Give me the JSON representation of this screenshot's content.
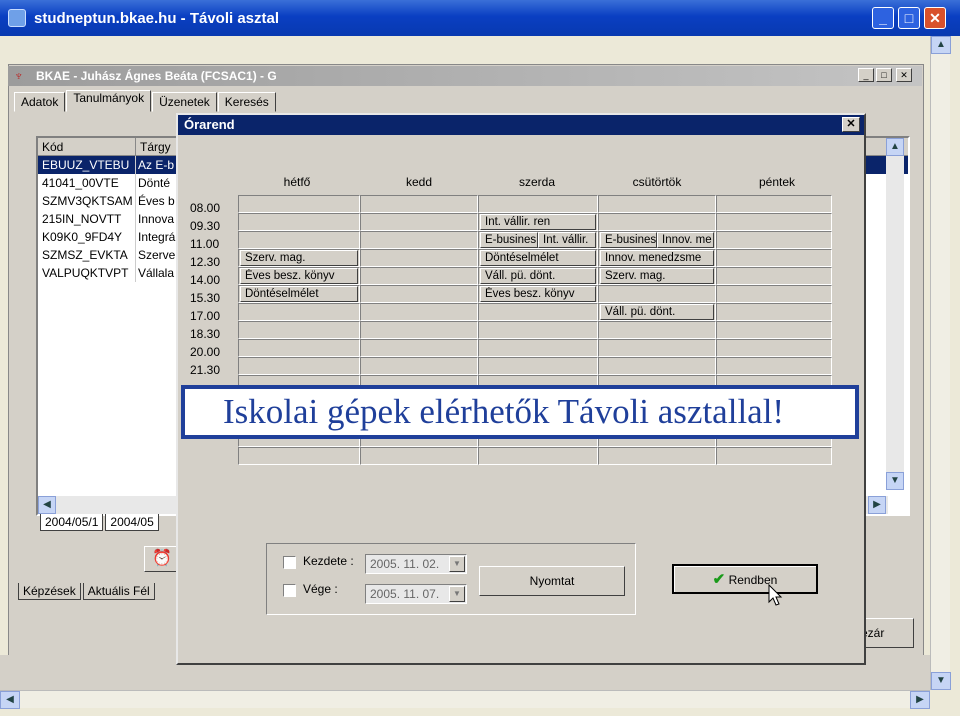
{
  "window": {
    "title": "studneptun.bkae.hu - Távoli asztal"
  },
  "app": {
    "title": "BKAE - Juhász Ágnes Beáta (FCSAC1) - G"
  },
  "tabs": [
    "Adatok",
    "Tanulmányok",
    "Üzenetek",
    "Keresés"
  ],
  "list": {
    "headers": [
      "Kód",
      "Tárgy"
    ],
    "rows": [
      {
        "code": "EBUUZ_VTEBU",
        "subject": "Az E-b",
        "selected": true
      },
      {
        "code": "41041_00VTE",
        "subject": "Dönté"
      },
      {
        "code": "SZMV3QKTSAM",
        "subject": "Éves b"
      },
      {
        "code": "215IN_NOVTT",
        "subject": "Innova"
      },
      {
        "code": "K09K0_9FD4Y",
        "subject": "Integrá"
      },
      {
        "code": "SZMSZ_EVKTA",
        "subject": "Szerve"
      },
      {
        "code": "VALPUQKTVPT",
        "subject": "Vállala"
      }
    ]
  },
  "semester_tabs": [
    "2004/05/1",
    "2004/05"
  ],
  "bottom_tabs": [
    "Képzések",
    "Aktuális Fél"
  ],
  "right_button": "ezár",
  "dialog": {
    "title": "Órarend",
    "days": [
      "hétfő",
      "kedd",
      "szerda",
      "csütörtök",
      "péntek"
    ],
    "times": [
      "08.00",
      "09.30",
      "11.00",
      "12.30",
      "14.00",
      "15.30",
      "17.00",
      "18.30",
      "20.00",
      "21.30"
    ],
    "events": [
      {
        "day": 0,
        "slot": 3,
        "label": "Szerv. mag."
      },
      {
        "day": 0,
        "slot": 4,
        "label": "Éves besz. könyv"
      },
      {
        "day": 0,
        "slot": 5,
        "label": "Döntéselmélet"
      },
      {
        "day": 2,
        "slot": 1,
        "label": "Int. vállir. ren"
      },
      {
        "day": 2,
        "slot": 2,
        "label": "E-busines",
        "half": 1
      },
      {
        "day": 2,
        "slot": 2,
        "label": "Int. vállir.",
        "half": 2
      },
      {
        "day": 2,
        "slot": 3,
        "label": "Döntéselmélet"
      },
      {
        "day": 2,
        "slot": 4,
        "label": "Váll. pü. dönt."
      },
      {
        "day": 2,
        "slot": 5,
        "label": "Éves besz. könyv"
      },
      {
        "day": 3,
        "slot": 2,
        "label": "E-busines",
        "half": 1
      },
      {
        "day": 3,
        "slot": 2,
        "label": "Innov. me",
        "half": 2
      },
      {
        "day": 3,
        "slot": 3,
        "label": "Innov. menedzsme"
      },
      {
        "day": 3,
        "slot": 4,
        "label": "Szerv. mag."
      },
      {
        "day": 3,
        "slot": 6,
        "label": "Váll. pü. dönt."
      }
    ],
    "start_label": "Kezdete :",
    "end_label": "Vége :",
    "start_date": "2005. 11. 02.",
    "end_date": "2005. 11. 07.",
    "print_button": "Nyomtat",
    "ok_button": "Rendben"
  },
  "banner": "Iskolai gépek elérhetők Távoli asztallal!",
  "colors": {
    "titlebar": "#0a3fc2",
    "dialog_title": "#0a246a",
    "banner_text": "#1f3f9a",
    "selection": "#0a246a"
  }
}
